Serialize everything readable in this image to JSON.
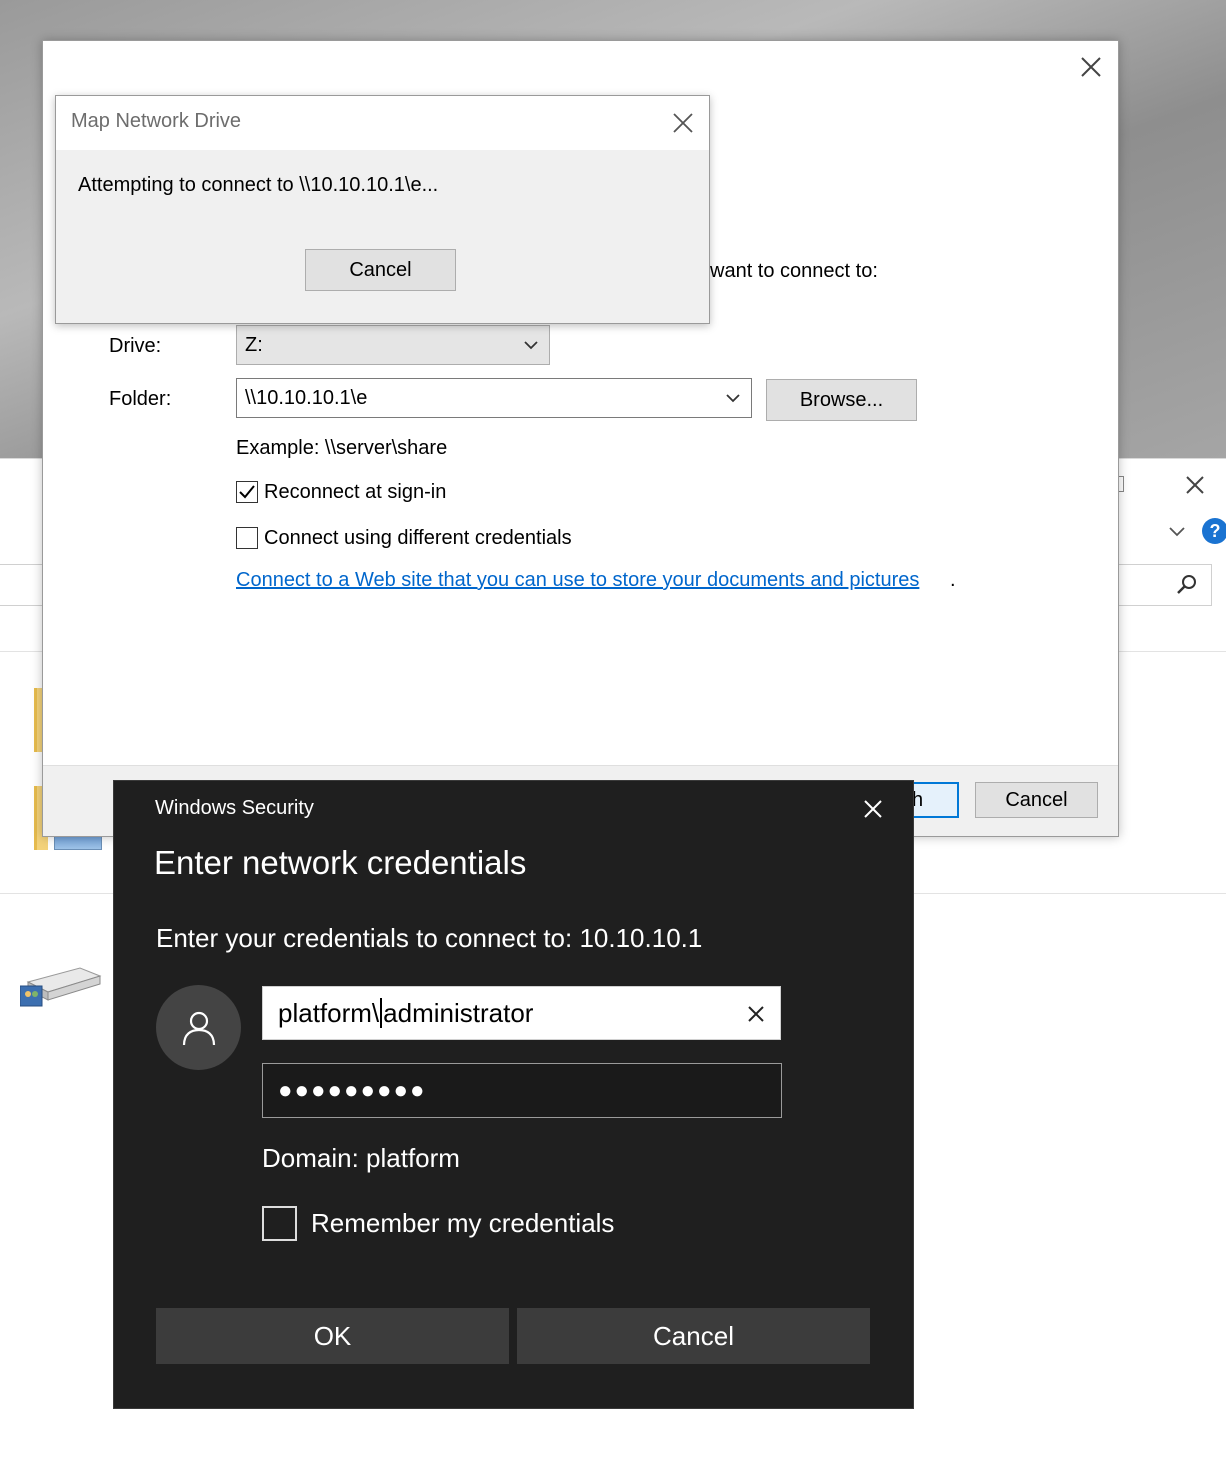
{
  "main_dialog": {
    "partial_prompt": " want to connect to:",
    "drive_label": "Drive:",
    "drive_value": "Z:",
    "folder_label": "Folder:",
    "folder_value": "\\\\10.10.10.1\\e",
    "browse_label": "Browse...",
    "example_text": "Example: \\\\server\\share",
    "reconnect_label": "Reconnect at sign-in",
    "reconnect_checked": true,
    "diff_creds_label": "Connect using different credentials",
    "diff_creds_checked": false,
    "web_link": "Connect to a Web site that you can use to store your documents and pictures",
    "web_link_suffix": ".",
    "finish_partial": "h",
    "cancel_label": "Cancel"
  },
  "connecting_dialog": {
    "title": "Map Network Drive",
    "message": "Attempting to connect to \\\\10.10.10.1\\e...",
    "cancel_label": "Cancel"
  },
  "security_dialog": {
    "app_title": "Windows Security",
    "heading": "Enter network credentials",
    "prompt": "Enter your credentials to connect to: 10.10.10.1",
    "username_before_caret": "platform\\",
    "username_after_caret": "administrator",
    "password_mask": "●●●●●●●●●",
    "domain_text": "Domain: platform",
    "remember_label": "Remember my credentials",
    "remember_checked": false,
    "ok_label": "OK",
    "cancel_label": "Cancel"
  },
  "colors": {
    "link": "#0066cc",
    "accent": "#0078d7",
    "security_bg": "#1f1f1f",
    "security_button": "#3c3c3c"
  }
}
